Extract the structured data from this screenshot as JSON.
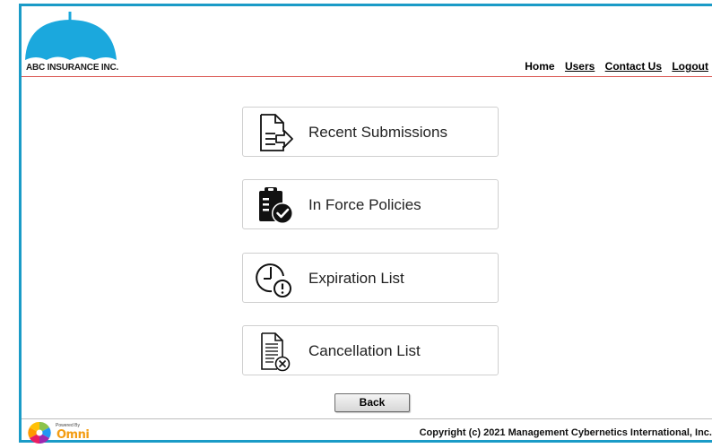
{
  "header": {
    "company": "ABC INSURANCE INC.",
    "nav": [
      "Home",
      "Users",
      "Contact Us",
      "Logout"
    ]
  },
  "menu": [
    {
      "label": "Recent Submissions",
      "icon": "document-arrow-icon"
    },
    {
      "label": "In Force Policies",
      "icon": "clipboard-check-icon"
    },
    {
      "label": "Expiration List",
      "icon": "clock-alert-icon"
    },
    {
      "label": "Cancellation List",
      "icon": "document-cancel-icon"
    }
  ],
  "back_label": "Back",
  "footer": {
    "powered_by": "Powered By",
    "brand": "Omni",
    "copyright": "Copyright (c) 2021 Management Cybernetics International, Inc."
  },
  "colors": {
    "border": "#1a9bc7",
    "umbrella": "#1ba8dd",
    "header_rule": "#d9534f"
  }
}
